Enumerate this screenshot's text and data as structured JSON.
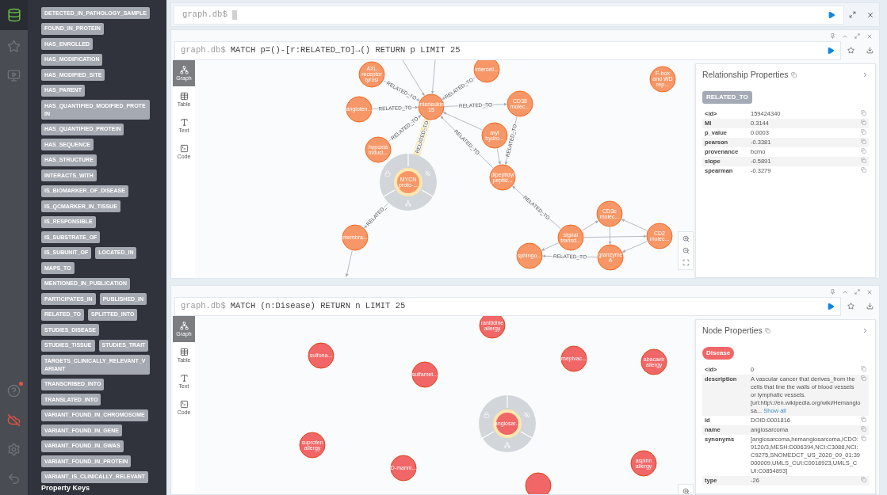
{
  "sidebar": {
    "relationship_types": [
      "DETECTED_IN_PATHOLOGY_SAMPLE",
      "FOUND_IN_PROTEIN",
      "HAS_ENROLLED",
      "HAS_MODIFICATION",
      "HAS_MODIFIED_SITE",
      "HAS_PARENT",
      "HAS_QUANTIFIED_MODIFIED_PROTEIN",
      "HAS_QUANTIFIED_PROTEIN",
      "HAS_SEQUENCE",
      "HAS_STRUCTURE",
      "INTERACTS_WITH",
      "IS_BIOMARKER_OF_DISEASE",
      "IS_QCMARKER_IN_TISSUE",
      "IS_RESPONSIBLE",
      "IS_SUBSTRATE_OF",
      "IS_SUBUNIT_OF",
      "LOCATED_IN",
      "MAPS_TO",
      "MENTIONED_IN_PUBLICATION",
      "PARTICIPATES_IN",
      "PUBLISHED_IN",
      "RELATED_TO",
      "SPLITTED_INTO",
      "STUDIES_DISEASE",
      "STUDIES_TISSUE",
      "STUDIES_TRAIT",
      "TARGETS_CLINICALLY_RELEVANT_VARIANT",
      "TRANSCRIBED_INTO",
      "TRANSLATED_INTO",
      "VARIANT_FOUND_IN_CHROMOSOME",
      "VARIANT_FOUND_IN_GENE",
      "VARIANT_FOUND_IN_GWAS",
      "VARIANT_FOUND_IN_PROTEIN",
      "VARIANT_IS_CLINICALLY_RELEVANT"
    ],
    "section_heading": "Property Keys"
  },
  "editor": {
    "prompt": "graph.db$"
  },
  "frames": [
    {
      "prompt": "graph.db$",
      "query": "MATCH p=()-[r:RELATED_TO]→() RETURN p LIMIT 25",
      "tabs": [
        {
          "label": "Graph",
          "selected": true
        },
        {
          "label": "Table",
          "selected": false
        },
        {
          "label": "Text",
          "selected": false
        },
        {
          "label": "Code",
          "selected": false
        }
      ],
      "nodes": [
        {
          "label_lines": [
            "AXL",
            "receptor",
            "tyrosi"
          ],
          "selected": false
        },
        {
          "label_lines": [
            "intercell..."
          ],
          "selected": false
        },
        {
          "label_lines": [
            "angioten..."
          ],
          "selected": false
        },
        {
          "label_lines": [
            "interleukin",
            "15"
          ],
          "selected": false
        },
        {
          "label_lines": [
            "CD38",
            "molec..."
          ],
          "selected": false
        },
        {
          "label_lines": [
            "aryl",
            "hydro..."
          ],
          "selected": false
        },
        {
          "label_lines": [
            "hypoxia",
            "induci..."
          ],
          "selected": false
        },
        {
          "label_lines": [
            "MYCN",
            "proto-..."
          ],
          "selected": true
        },
        {
          "label_lines": [
            "dipeptidyl",
            "peptid..."
          ],
          "selected": false
        },
        {
          "label_lines": [
            "F-box",
            "and WD",
            "rep..."
          ],
          "selected": false
        },
        {
          "label_lines": [
            "membra..."
          ],
          "selected": false
        },
        {
          "label_lines": [
            "CD3e",
            "molec..."
          ],
          "selected": false
        },
        {
          "label_lines": [
            "signal",
            "transd..."
          ],
          "selected": false
        },
        {
          "label_lines": [
            "CD2",
            "molec..."
          ],
          "selected": false
        },
        {
          "label_lines": [
            "sphingo..."
          ],
          "selected": false
        },
        {
          "label_lines": [
            "granzyme",
            "A"
          ],
          "selected": false
        }
      ],
      "edges": [
        {
          "label": "RELATED_TO",
          "selected": false
        },
        {
          "label": "RELATED_TO",
          "selected": false
        },
        {
          "label": "RELATED_TO",
          "selected": false
        },
        {
          "label": "RELATED_TO",
          "selected": false
        },
        {
          "label": "RELATED_TO",
          "selected": false
        },
        {
          "selected": false
        },
        {
          "label": "RELATED_TO",
          "selected": true
        },
        {
          "label": "RELATED_TO",
          "selected": false
        },
        {
          "label": "RELATED_TO",
          "selected": false
        },
        {
          "selected": false
        },
        {
          "label": "RELATED_",
          "selected": false
        },
        {
          "selected": false
        },
        {
          "label": "RELATED_TO",
          "selected": false
        },
        {
          "selected": false
        },
        {
          "selected": false
        },
        {
          "selected": false
        },
        {
          "selected": false
        },
        {
          "selected": false
        },
        {
          "selected": false
        },
        {
          "label": "RELATED_TO",
          "selected": false
        },
        {
          "selected": false
        },
        {
          "selected": false
        }
      ],
      "properties": {
        "title": "Relationship Properties",
        "badge": "RELATED_TO",
        "rows": [
          {
            "key": "<id>",
            "value": "159424340"
          },
          {
            "key": "MI",
            "value": "0.3144"
          },
          {
            "key": "p_value",
            "value": "0.0003"
          },
          {
            "key": "pearson",
            "value": "-0.3381"
          },
          {
            "key": "provenance",
            "value": "bcmo"
          },
          {
            "key": "slope",
            "value": "-0.5891"
          },
          {
            "key": "spearman",
            "value": "-0.3279"
          }
        ]
      }
    },
    {
      "prompt": "graph.db$",
      "query": "MATCH (n:Disease) RETURN n LIMIT 25",
      "tabs": [
        {
          "label": "Graph",
          "selected": true
        },
        {
          "label": "Table",
          "selected": false
        },
        {
          "label": "Text",
          "selected": false
        },
        {
          "label": "Code",
          "selected": false
        }
      ],
      "nodes": [
        {
          "label_lines": [
            "ranitidine",
            "allergy"
          ],
          "selected": false
        },
        {
          "label_lines": [
            "sulfona..."
          ],
          "selected": false
        },
        {
          "label_lines": [
            "sulfamet..."
          ],
          "selected": false
        },
        {
          "label_lines": [
            "mepivac..."
          ],
          "selected": false
        },
        {
          "label_lines": [
            "abacavir",
            "allergy"
          ],
          "selected": false
        },
        {
          "label_lines": [
            "angiosar..."
          ],
          "selected": true
        },
        {
          "label_lines": [
            "suprofen",
            "allergy"
          ],
          "selected": false
        },
        {
          "label_lines": [
            "D-manni..."
          ],
          "selected": false
        },
        {
          "label_lines": [
            "aspirin",
            "allergy"
          ],
          "selected": false
        },
        {
          "selected": false
        }
      ],
      "properties": {
        "title": "Node Properties",
        "badge": "Disease",
        "rows": [
          {
            "key": "<id>",
            "value": "0"
          },
          {
            "key": "description",
            "value": "A vascular cancer that derives_from the cells that line the walls of blood vessels or lymphatic vessels. [url:http\\://en.wikipedia.org/wiki/Hemangiosa...",
            "link": "Show all"
          },
          {
            "key": "id",
            "value": "DOID:0001816"
          },
          {
            "key": "name",
            "value": "angiosarcoma"
          },
          {
            "key": "synonyms",
            "value": "[angiosarcoma,hemangiosarcoma,ICDO:9120/3,MESH:D006394,NCI:C3088,NCI:C9275,SNOMEDCT_US_2020_09_01:39000009,UMLS_CUI:C0018923,UMLS_CUI:C0854893]"
          },
          {
            "key": "type",
            "value": "-26"
          }
        ]
      }
    }
  ]
}
